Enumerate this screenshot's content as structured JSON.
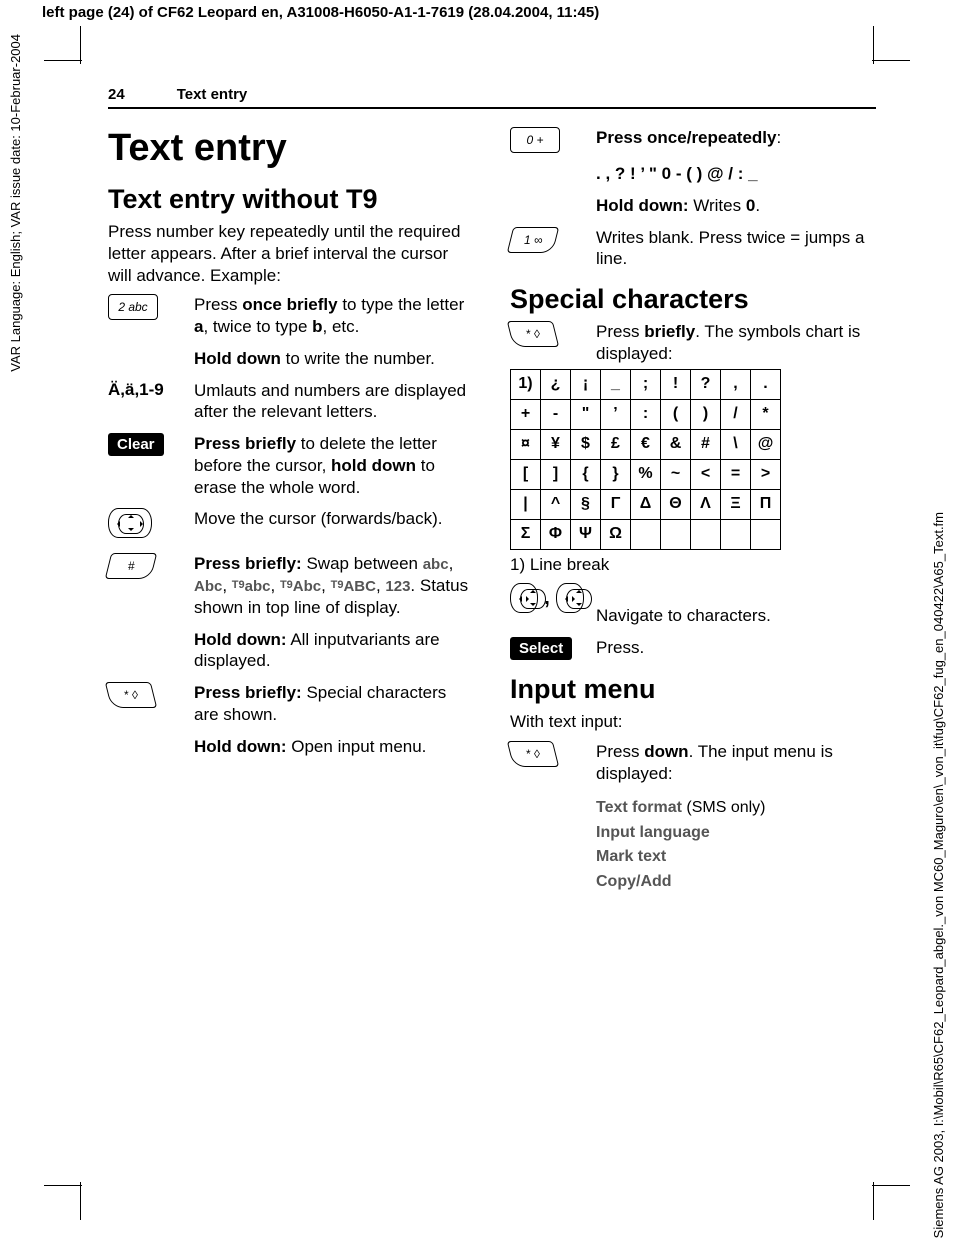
{
  "meta": {
    "top_header": "left page (24) of CF62 Leopard en, A31008-H6050-A1-1-7619 (28.04.2004, 11:45)",
    "left_margin": "VAR Language: English; VAR issue date: 10-Februar-2004",
    "right_margin": "Siemens AG 2003, I:\\Mobil\\R65\\CF62_Leopard_abgel._von MC60_Maguro\\en\\_von_it\\fug\\CF62_fug_en_040422\\A65_Text.fm"
  },
  "running_head": {
    "page_number": "24",
    "title": "Text entry"
  },
  "left_col": {
    "h1": "Text entry",
    "h2": "Text entry without T9",
    "intro": "Press number key repeatedly until the required letter appears. After a brief interval the cursor will advance. Example:",
    "items": {
      "key2": {
        "label": "2 abc",
        "d1a": "Press ",
        "d1b": "once briefly",
        "d1c": " to type the letter ",
        "d1d": "a",
        "d1e": ", twice to type ",
        "d1f": "b",
        "d1g": ", etc.",
        "d2a": "Hold down",
        "d2b": " to write the number."
      },
      "umlaut": {
        "label": "Ä,ä,1-9",
        "d1": "Umlauts and numbers are displayed after the relevant letters."
      },
      "clear": {
        "label": "Clear",
        "d1a": "Press briefly",
        "d1b": " to delete the letter before the cursor, ",
        "d1c": "hold down",
        "d1d": " to erase the whole word."
      },
      "nav": {
        "d1": "Move the cursor (forwards/back)."
      },
      "hash": {
        "label": "#",
        "d1a": "Press briefly:",
        "d1b": " Swap between ",
        "modes": {
          "m1": "abc",
          "m2": "Abc",
          "m3p": "T9",
          "m3": "abc",
          "m4p": "T9",
          "m4": "Abc",
          "m5p": "T9",
          "m5": "ABC",
          "m6": "123"
        },
        "d1c": ". Status shown in top line of display.",
        "d2a": "Hold down:",
        "d2b": " All inputvariants are displayed."
      },
      "star": {
        "label": "* ◊",
        "d1a": "Press briefly:",
        "d1b": " Special characters are shown.",
        "d2a": "Hold down:",
        "d2b": " Open input menu."
      }
    }
  },
  "right_col": {
    "zero": {
      "label": "0 +",
      "d1a": "Press once/repeatedly",
      "d1b": ":",
      "chars": ". , ? ! ’ \" 0 - ( ) @ / : _",
      "d2a": "Hold down:",
      "d2b": " Writes ",
      "d2c": "0",
      "d2d": "."
    },
    "one": {
      "label": "1 ∞",
      "d1": "Writes blank. Press twice = jumps a line."
    },
    "special": {
      "heading": "Special characters",
      "star_label": "* ◊",
      "d1a": "Press ",
      "d1b": "briefly",
      "d1c": ". The symbols chart is displayed:",
      "table": [
        [
          "1)",
          "¿",
          "¡",
          "_",
          ";",
          "!",
          "?",
          ",",
          "."
        ],
        [
          "+",
          "-",
          "\"",
          "’",
          ":",
          "(",
          ")",
          "/",
          "*"
        ],
        [
          "¤",
          "¥",
          "$",
          "£",
          "€",
          "&",
          "#",
          "\\",
          "@"
        ],
        [
          "[",
          "]",
          "{",
          "}",
          "%",
          "~",
          "<",
          "=",
          ">"
        ],
        [
          "|",
          "^",
          "§",
          "Γ",
          "Δ",
          "Θ",
          "Λ",
          "Ξ",
          "Π"
        ],
        [
          "Σ",
          "Φ",
          "Ψ",
          "Ω",
          "",
          "",
          "",
          "",
          ""
        ]
      ],
      "footnote": "1) Line break",
      "nav_desc": "Navigate to characters.",
      "select_label": "Select",
      "select_desc": "Press."
    },
    "input_menu": {
      "heading": "Input menu",
      "lead": "With text input:",
      "star_label": "* ◊",
      "d1a": "Press ",
      "d1b": "down",
      "d1c": ". The input menu is displayed:",
      "items": {
        "i1": "Text format",
        "i1_suffix": " (SMS only)",
        "i2": "Input language",
        "i3": "Mark text",
        "i4": "Copy/Add"
      }
    }
  }
}
